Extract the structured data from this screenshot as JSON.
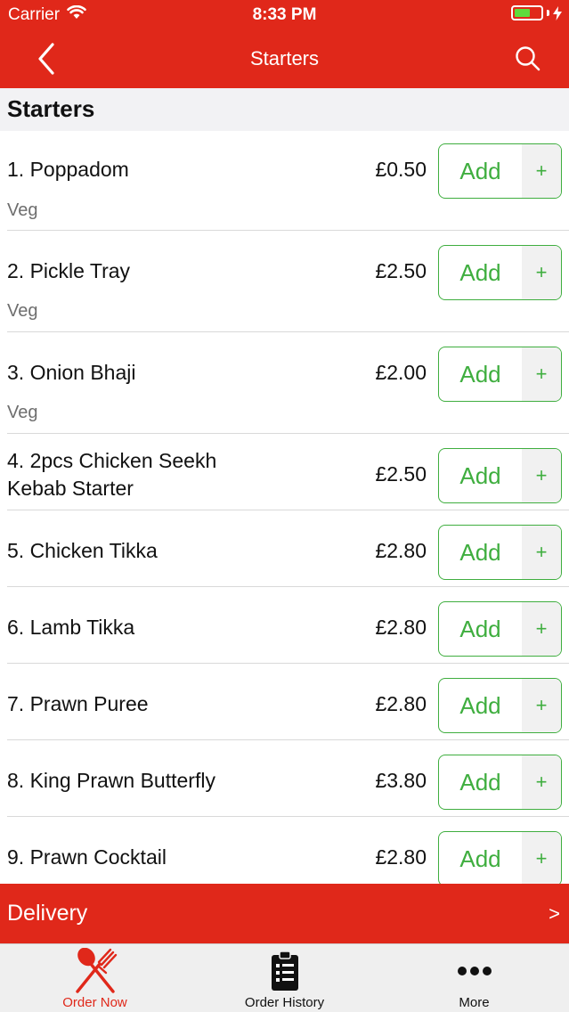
{
  "status_bar": {
    "carrier": "Carrier",
    "time": "8:33 PM"
  },
  "nav": {
    "title": "Starters"
  },
  "section": {
    "title": "Starters"
  },
  "colors": {
    "brand_red": "#e0281a",
    "add_green": "#3fae3f",
    "tab_active": "#e0281a"
  },
  "items": [
    {
      "name": "1. Poppadom",
      "sub": "Veg",
      "price": "£0.50",
      "add_label": "Add",
      "plus_label": "+"
    },
    {
      "name": "2. Pickle Tray",
      "sub": "Veg",
      "price": "£2.50",
      "add_label": "Add",
      "plus_label": "+"
    },
    {
      "name": "3. Onion Bhaji",
      "sub": "Veg",
      "price": "£2.00",
      "add_label": "Add",
      "plus_label": "+"
    },
    {
      "name": "4. 2pcs Chicken Seekh Kebab Starter",
      "sub": "",
      "price": "£2.50",
      "add_label": "Add",
      "plus_label": "+"
    },
    {
      "name": "5. Chicken Tikka",
      "sub": "",
      "price": "£2.80",
      "add_label": "Add",
      "plus_label": "+"
    },
    {
      "name": "6. Lamb Tikka",
      "sub": "",
      "price": "£2.80",
      "add_label": "Add",
      "plus_label": "+"
    },
    {
      "name": "7. Prawn Puree",
      "sub": "",
      "price": "£2.80",
      "add_label": "Add",
      "plus_label": "+"
    },
    {
      "name": "8. King Prawn Butterfly",
      "sub": "",
      "price": "£3.80",
      "add_label": "Add",
      "plus_label": "+"
    },
    {
      "name": "9. Prawn Cocktail",
      "sub": "",
      "price": "£2.80",
      "add_label": "Add",
      "plus_label": "+"
    }
  ],
  "delivery": {
    "label": "Delivery",
    "arrow": ">"
  },
  "tabs": [
    {
      "label": "Order Now",
      "icon": "fork-knife-icon",
      "active": true
    },
    {
      "label": "Order History",
      "icon": "clipboard-list-icon",
      "active": false
    },
    {
      "label": "More",
      "icon": "more-dots-icon",
      "active": false
    }
  ]
}
